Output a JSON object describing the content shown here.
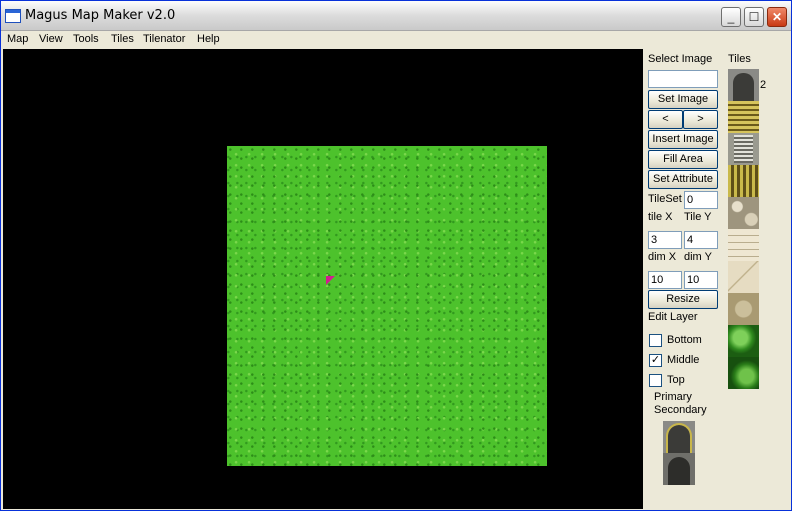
{
  "window": {
    "title": "Magus Map Maker v2.0"
  },
  "titlebar_buttons": {
    "minimize": "_",
    "maximize": "☐",
    "close": "✕"
  },
  "menu": [
    "Map",
    "View",
    "Tools",
    "Tiles",
    "Tilenator",
    "Help"
  ],
  "panel": {
    "select_image_label": "Select Image",
    "tiles_label": "Tiles",
    "select_image_value": "",
    "set_image_button": "Set Image",
    "prev_button": "<",
    "next_button": ">",
    "insert_image_button": "Insert Image",
    "fill_area_button": "Fill Area",
    "set_attribute_button": "Set Attribute",
    "tileset_label": "TileSet",
    "tileset_value": "0",
    "tile_x_label": "tile X",
    "tile_y_label": "Tile Y",
    "tile_x_value": "3",
    "tile_y_value": "4",
    "dim_x_label": "dim X",
    "dim_y_label": "dim Y",
    "dim_x_value": "10",
    "dim_y_value": "10",
    "resize_button": "Resize",
    "edit_layer_label": "Edit Layer",
    "layers": [
      {
        "label": "Bottom",
        "checked": false
      },
      {
        "label": "Middle",
        "checked": true
      },
      {
        "label": "Top",
        "checked": false
      }
    ],
    "primary_label": "Primary",
    "secondary_label": "Secondary",
    "tile_strip_number": "2",
    "tile_strip_icons": [
      "door-tile",
      "stairs-tile",
      "ladder-tile",
      "bars-tile",
      "cobble-tile",
      "brick-tile",
      "cracked-stone-tile",
      "stone-tile",
      "bush-tile",
      "bush-tile"
    ]
  },
  "colors": {
    "grass": "#4dc22c",
    "cursor": "#d21c8f",
    "canvas_bg": "#000000"
  }
}
